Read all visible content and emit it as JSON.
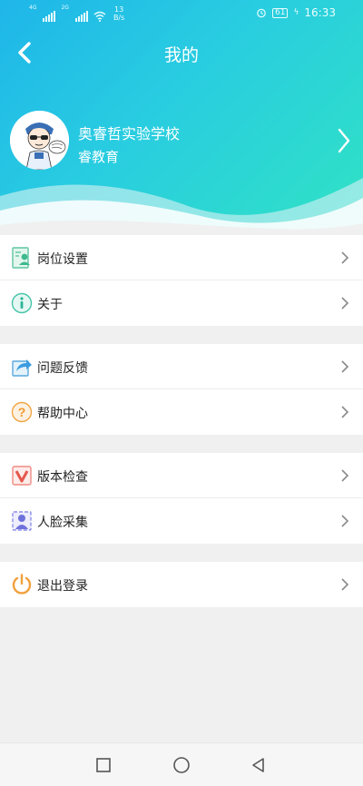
{
  "status_bar": {
    "net1": "4G",
    "net2": "2G",
    "speed_value": "13",
    "speed_unit": "B/s",
    "battery": "61",
    "time": "16:33"
  },
  "header": {
    "title": "我的",
    "org_name": "奥睿哲实验学校",
    "sub_name": "睿教育"
  },
  "groups": [
    [
      {
        "label": "岗位设置",
        "icon": "job-settings-icon"
      },
      {
        "label": "关于",
        "icon": "info-icon"
      }
    ],
    [
      {
        "label": "问题反馈",
        "icon": "feedback-share-icon"
      },
      {
        "label": "帮助中心",
        "icon": "help-icon"
      }
    ],
    [
      {
        "label": "版本检查",
        "icon": "version-check-icon"
      },
      {
        "label": "人脸采集",
        "icon": "face-capture-icon"
      }
    ],
    [
      {
        "label": "退出登录",
        "icon": "power-icon"
      }
    ]
  ],
  "colors": {
    "header_start": "#1fb6e9",
    "header_end": "#30e2c4",
    "logout_orange": "#f2a03d"
  }
}
